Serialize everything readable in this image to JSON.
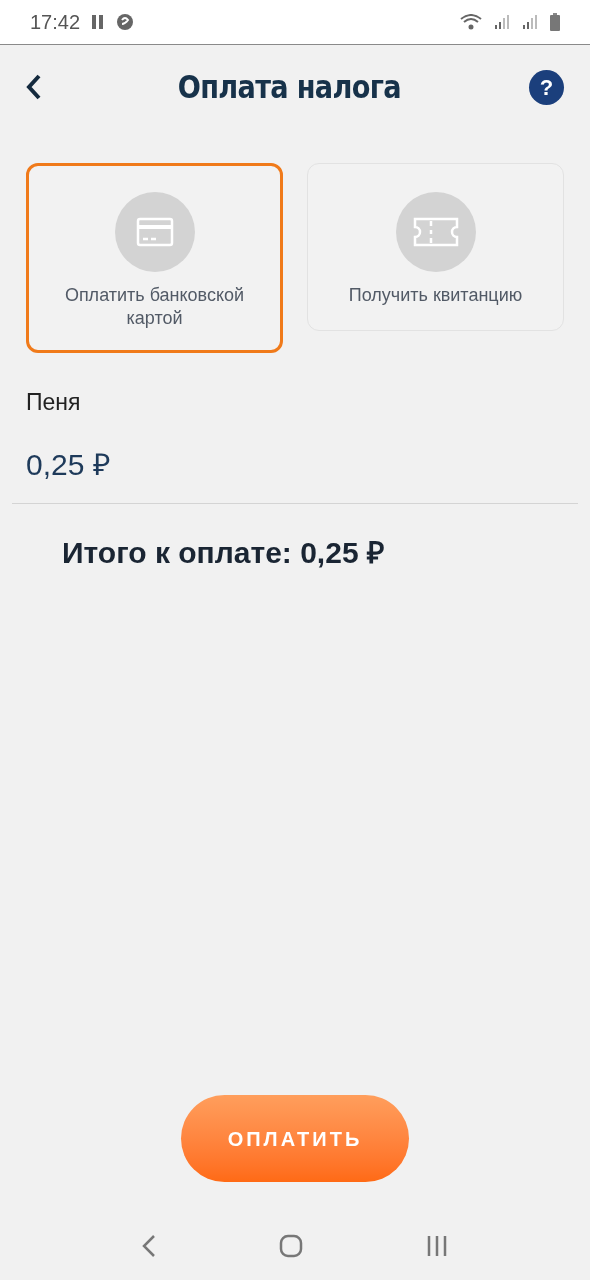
{
  "status_bar": {
    "time": "17:42"
  },
  "header": {
    "title": "Оплата налога",
    "help": "?"
  },
  "options": [
    {
      "label": "Оплатить банковской картой",
      "kind": "card",
      "selected": true
    },
    {
      "label": "Получить квитанцию",
      "kind": "receipt",
      "selected": false
    }
  ],
  "fee": {
    "label": "Пеня",
    "value": "0,25 ₽"
  },
  "total": "Итого к оплате: 0,25 ₽",
  "pay_button": "ОПЛАТИТЬ"
}
